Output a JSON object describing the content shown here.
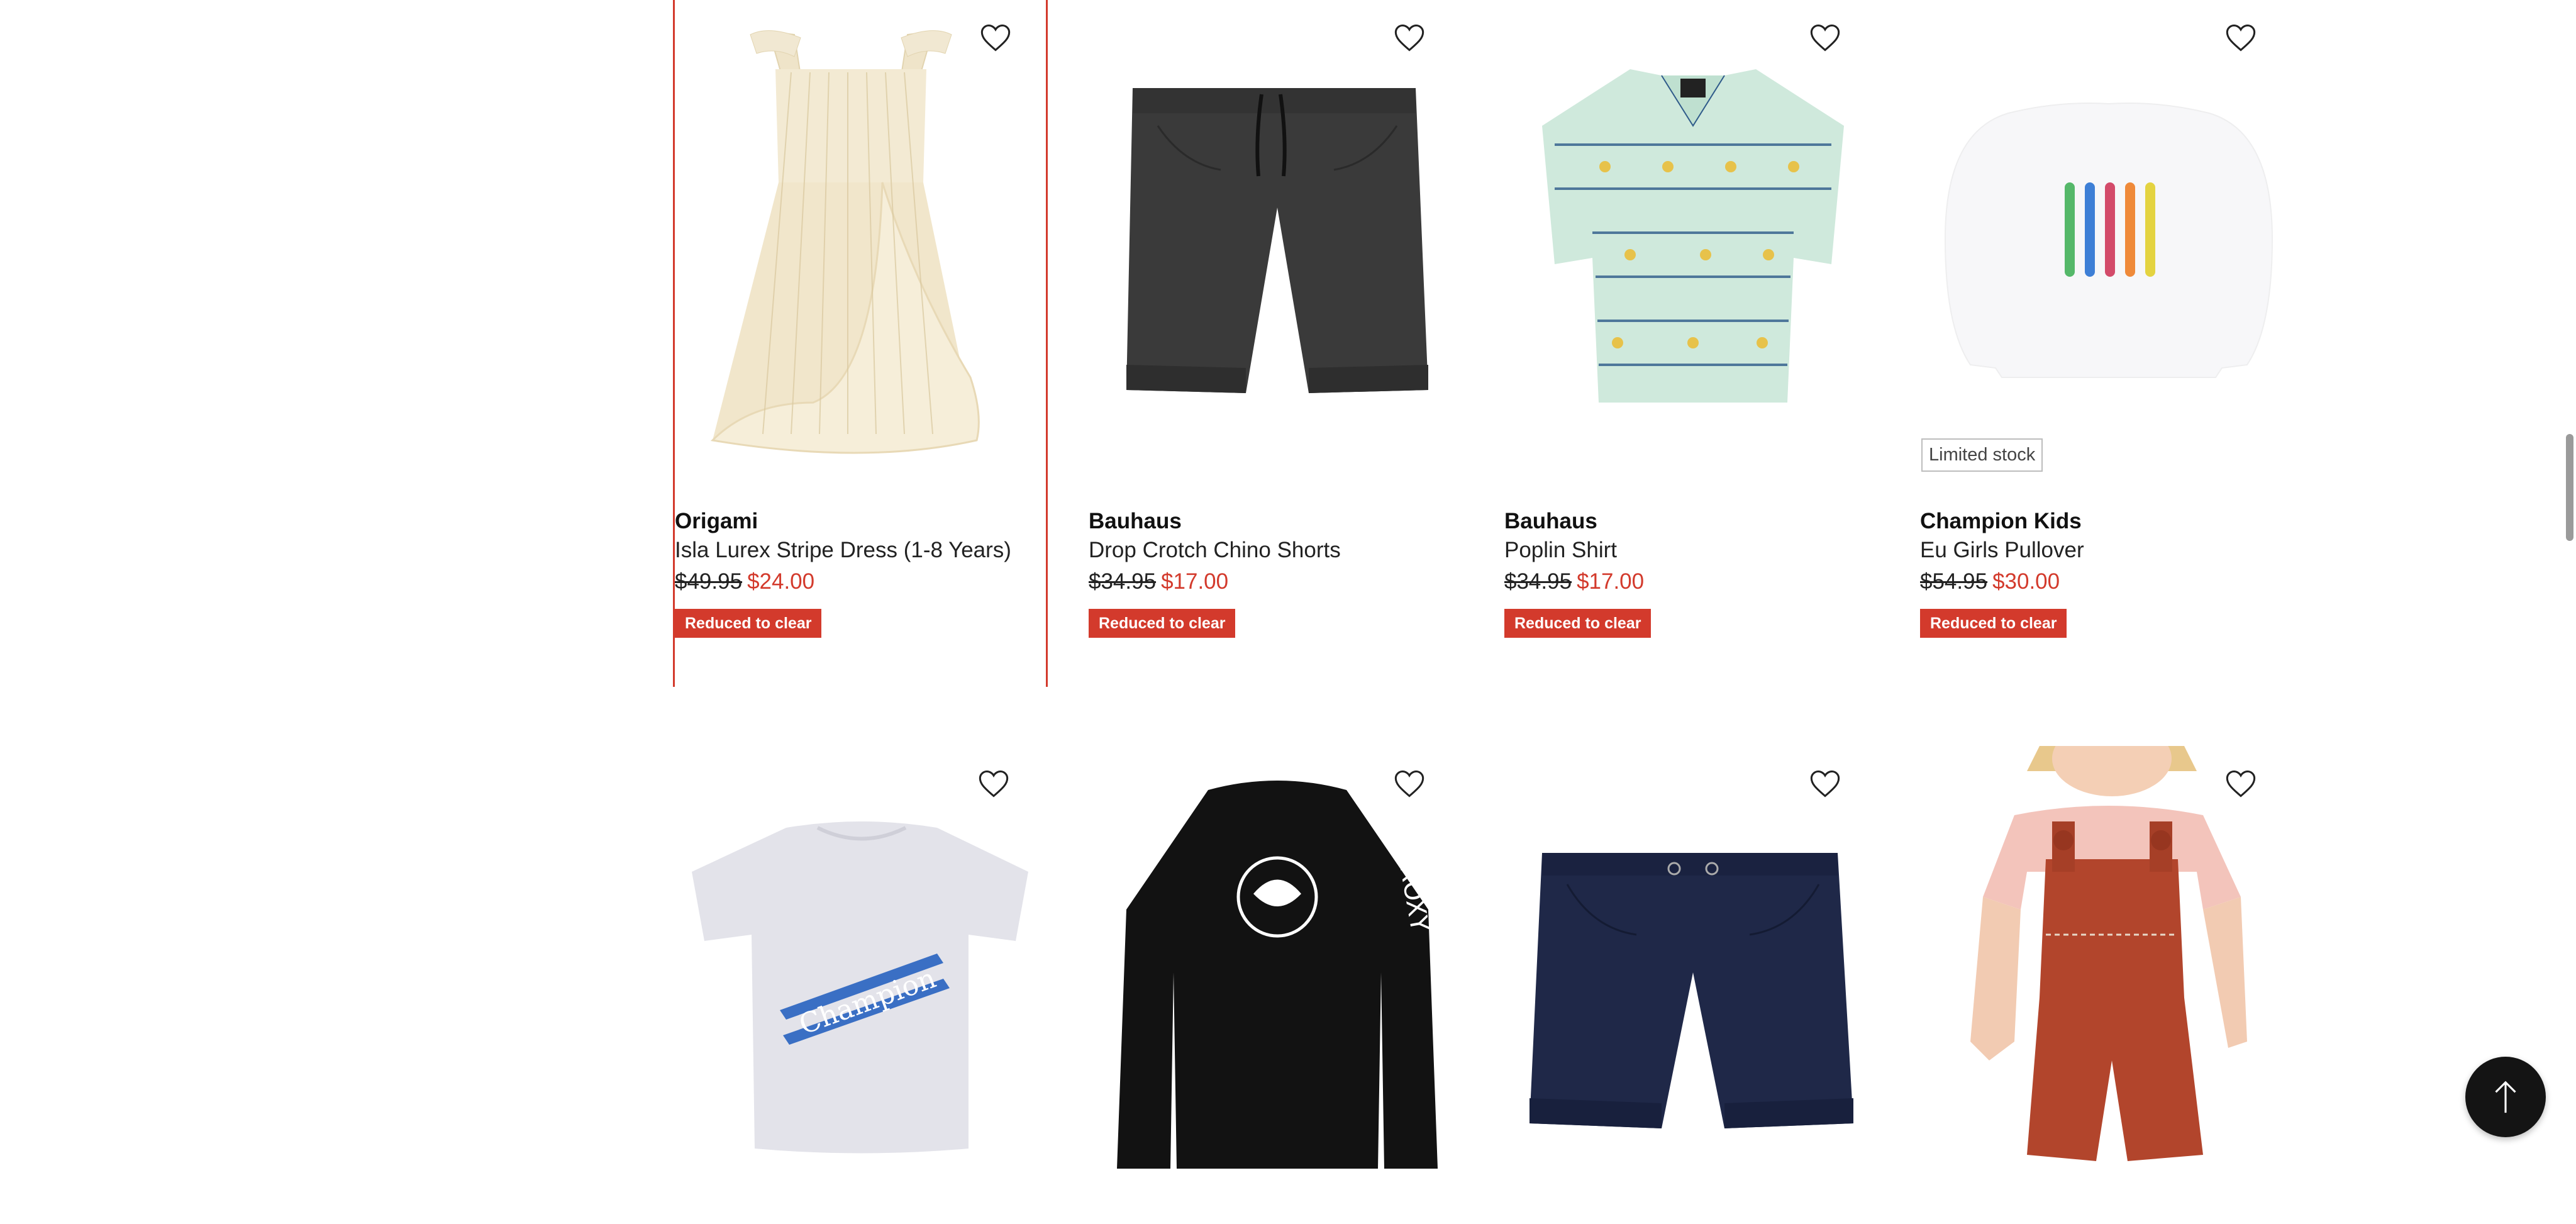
{
  "products": [
    {
      "brand": "Origami",
      "name": "Isla Lurex Stripe Dress (1-8 Years)",
      "was_price": "$49.95",
      "now_price": "$24.00",
      "badge": "Reduced to clear",
      "image": "cream-striped-dress",
      "selected": true
    },
    {
      "brand": "Bauhaus",
      "name": "Drop Crotch Chino Shorts",
      "was_price": "$34.95",
      "now_price": "$17.00",
      "badge": "Reduced to clear",
      "image": "charcoal-chino-shorts"
    },
    {
      "brand": "Bauhaus",
      "name": "Poplin Shirt",
      "was_price": "$34.95",
      "now_price": "$17.00",
      "badge": "Reduced to clear",
      "image": "mint-palm-print-shirt"
    },
    {
      "brand": "Champion Kids",
      "name": "Eu Girls Pullover",
      "was_price": "$54.95",
      "now_price": "$30.00",
      "badge": "Reduced to clear",
      "stock_label": "Limited stock",
      "image": "white-long-sleeve-pullover"
    },
    {
      "image": "lilac-champion-tee"
    },
    {
      "image": "black-roxy-rash-vest"
    },
    {
      "image": "navy-drawstring-shorts"
    },
    {
      "image": "rust-overalls-child"
    }
  ],
  "icons": {
    "wishlist": "heart-outline-icon",
    "back_to_top": "arrow-up-icon"
  },
  "colors": {
    "sale_red": "#d33a2c",
    "highlight_border": "#d33a2c",
    "text": "#111111",
    "back_to_top_bg": "#141414"
  }
}
